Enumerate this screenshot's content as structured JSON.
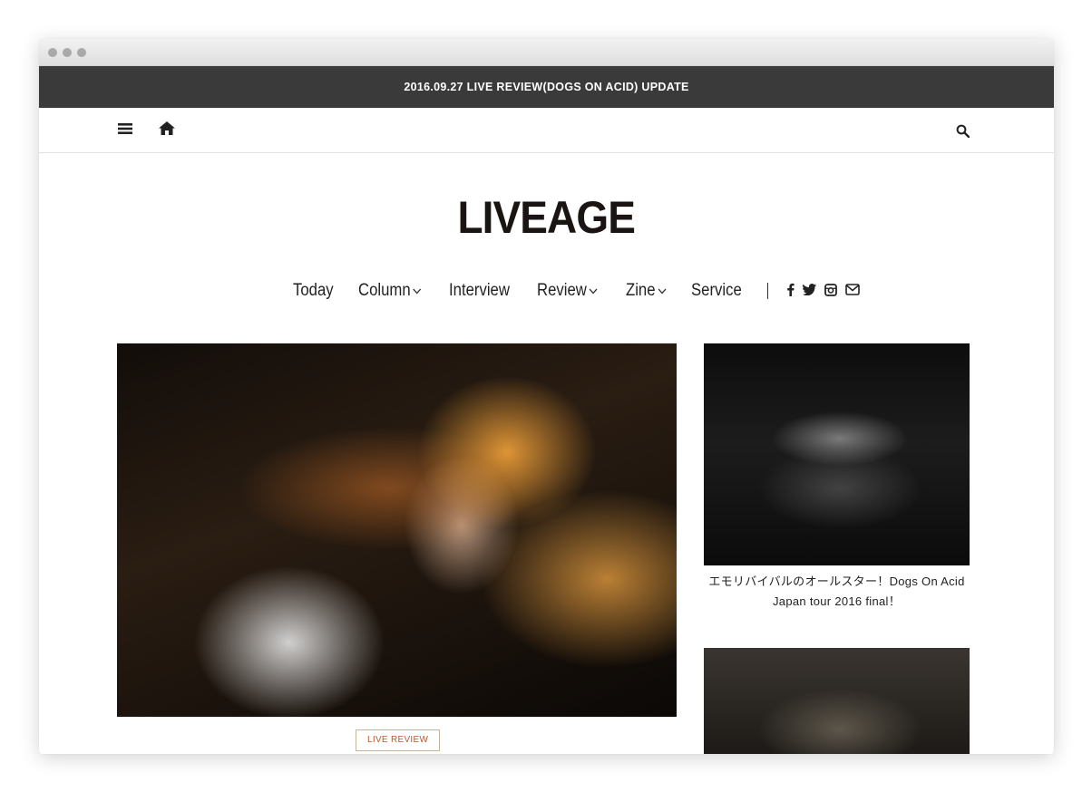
{
  "window": {
    "controls": [
      "close",
      "minimize",
      "zoom"
    ]
  },
  "notice_bar": {
    "text": "2016.09.27 LIVE REVIEW(DOGS ON ACID) UPDATE"
  },
  "toolbar": {
    "menu_icon": "hamburger-menu-icon",
    "home_icon": "home-icon",
    "search_icon": "search-icon"
  },
  "site": {
    "logo": "LIVEAGE"
  },
  "nav": {
    "items": [
      {
        "label": "Today",
        "dropdown": false
      },
      {
        "label": "Column",
        "dropdown": true
      },
      {
        "label": "Interview",
        "dropdown": false
      },
      {
        "label": "Review",
        "dropdown": true
      },
      {
        "label": "Zine",
        "dropdown": true
      },
      {
        "label": "Service",
        "dropdown": false
      }
    ],
    "social": [
      "facebook-icon",
      "twitter-icon",
      "instagram-icon",
      "mail-icon"
    ]
  },
  "featured": {
    "tag": "LIVE REVIEW"
  },
  "sidebar": {
    "posts": [
      {
        "title": "エモリバイバルのオールスター！Dogs On Acid Japan tour 2016 final！"
      },
      {
        "title": ""
      }
    ]
  },
  "colors": {
    "notice_bg": "#3a3a3a",
    "tag_text": "#b55a2f",
    "tag_border": "#c7b49c"
  }
}
